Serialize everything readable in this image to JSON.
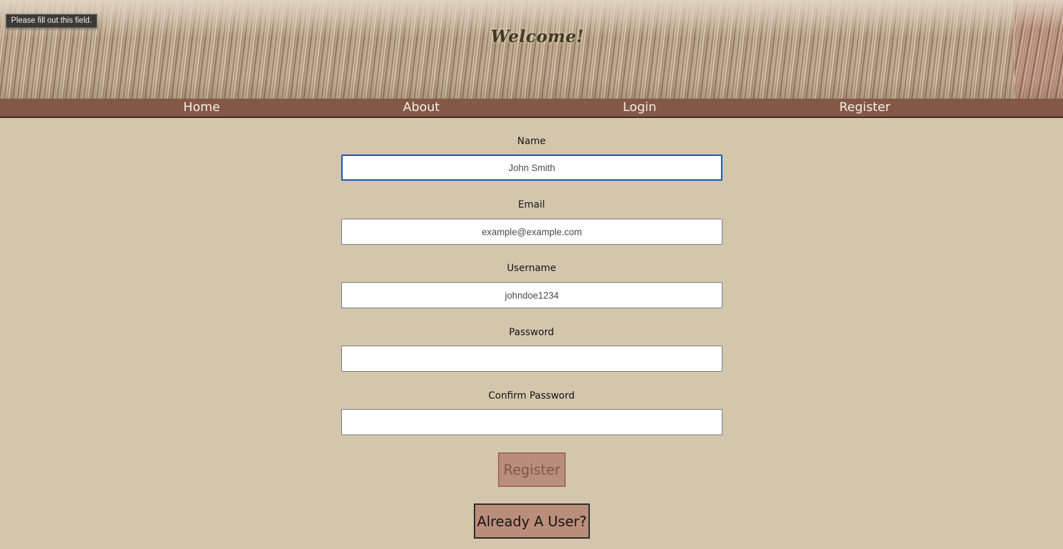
{
  "header": {
    "title": "Welcome!"
  },
  "tooltip": {
    "text": "Please fill out this field."
  },
  "nav": {
    "items": [
      {
        "label": "Home"
      },
      {
        "label": "About"
      },
      {
        "label": "Login"
      },
      {
        "label": "Register"
      }
    ]
  },
  "form": {
    "fields": [
      {
        "label": "Name",
        "placeholder": "John Smith",
        "value": ""
      },
      {
        "label": "Email",
        "placeholder": "example@example.com",
        "value": ""
      },
      {
        "label": "Username",
        "placeholder": "johndoe1234",
        "value": ""
      },
      {
        "label": "Password",
        "placeholder": "",
        "value": ""
      },
      {
        "label": "Confirm Password",
        "placeholder": "",
        "value": ""
      }
    ],
    "register_label": "Register",
    "already_user_label": "Already A User?"
  },
  "colors": {
    "background": "#d4c6ad",
    "nav_bar": "#835848",
    "button": "#bb8d7b",
    "focus_ring": "#1a56b0"
  }
}
